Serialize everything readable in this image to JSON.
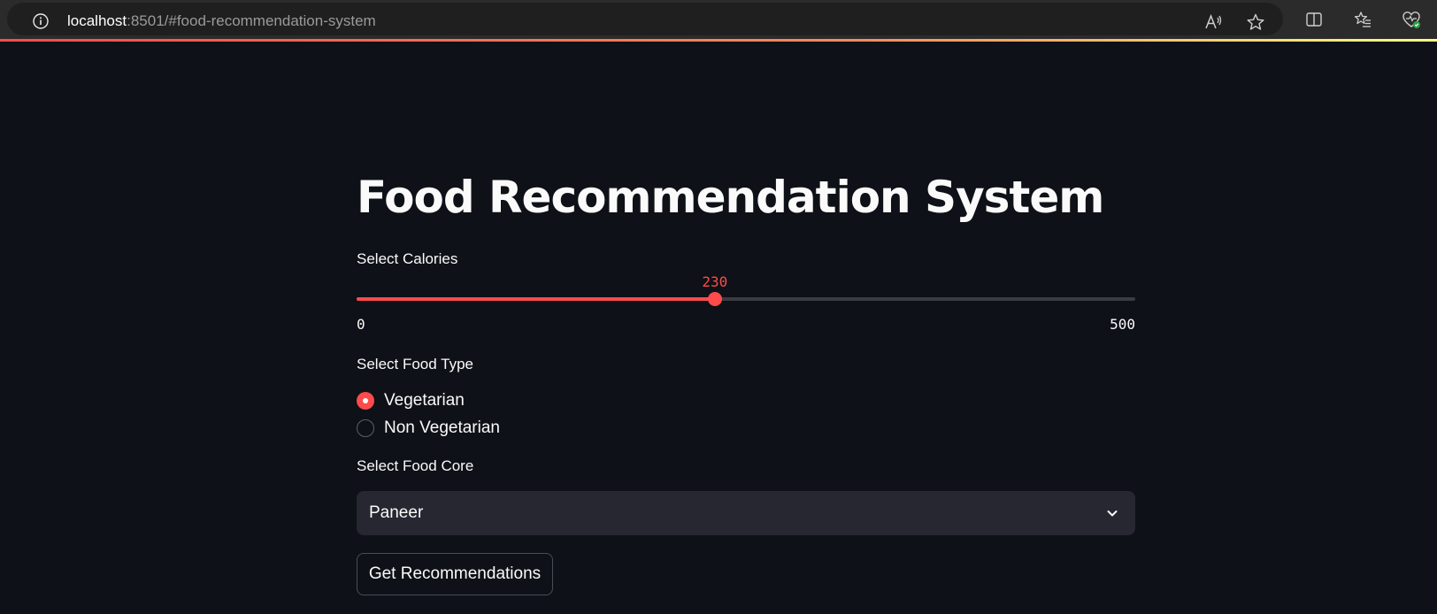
{
  "browser": {
    "url_host": "localhost",
    "url_rest": ":8501/#food-recommendation-system",
    "icons": [
      "info-icon",
      "read-aloud-icon",
      "favorite-star-icon",
      "split-screen-icon",
      "favorites-icon",
      "browser-essentials-icon"
    ]
  },
  "colors": {
    "background": "#0e1117",
    "accent": "#ff4b4b",
    "text": "#fafafa",
    "input_bg": "#262730"
  },
  "app": {
    "title": "Food Recommendation System",
    "calories": {
      "label": "Select Calories",
      "min": 0,
      "max": 500,
      "value": 230,
      "min_label": "0",
      "max_label": "500",
      "value_label": "230"
    },
    "food_type": {
      "label": "Select Food Type",
      "options": [
        "Vegetarian",
        "Non Vegetarian"
      ],
      "selected": "Vegetarian"
    },
    "food_core": {
      "label": "Select Food Core",
      "selected": "Paneer"
    },
    "submit_label": "Get Recommendations"
  }
}
